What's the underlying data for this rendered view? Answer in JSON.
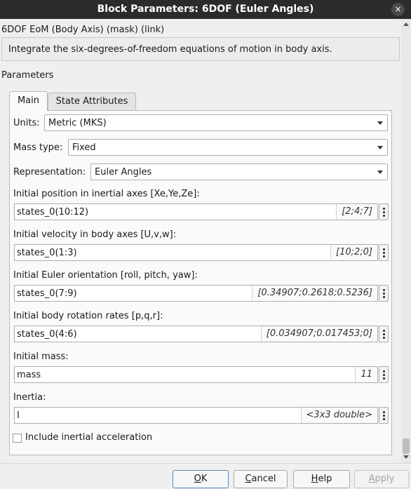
{
  "window": {
    "title": "Block Parameters: 6DOF (Euler Angles)",
    "close_icon": "×"
  },
  "header": {
    "mask_line": "6DOF EoM (Body Axis) (mask) (link)",
    "description": "Integrate the six-degrees-of-freedom equations of motion in body axis.",
    "parameters_label": "Parameters"
  },
  "tabs": [
    {
      "label": "Main",
      "active": true
    },
    {
      "label": "State Attributes",
      "active": false
    }
  ],
  "main": {
    "units": {
      "label": "Units:",
      "value": "Metric (MKS)"
    },
    "mass_type": {
      "label": "Mass type:",
      "value": "Fixed"
    },
    "representation": {
      "label": "Representation:",
      "value": "Euler Angles"
    },
    "fields": [
      {
        "label": "Initial position in inertial axes [Xe,Ye,Ze]:",
        "value": "states_0(10:12)",
        "hint": "[2;4;7]"
      },
      {
        "label": "Initial velocity in body axes [U,v,w]:",
        "value": "states_0(1:3)",
        "hint": "[10;2;0]"
      },
      {
        "label": "Initial Euler orientation [roll, pitch, yaw]:",
        "value": "states_0(7:9)",
        "hint": "[0.34907;0.2618;0.5236]"
      },
      {
        "label": "Initial body rotation rates [p,q,r]:",
        "value": "states_0(4:6)",
        "hint": "[0.034907;0.017453;0]"
      },
      {
        "label": "Initial mass:",
        "value": "mass",
        "hint": "11"
      },
      {
        "label": "Inertia:",
        "value": "I",
        "hint": "<3x3 double>"
      }
    ],
    "checkbox": {
      "label": "Include inertial acceleration",
      "checked": false
    }
  },
  "buttons": {
    "ok_mnemonic": "O",
    "ok_rest": "K",
    "cancel_mnemonic": "C",
    "cancel_rest": "ancel",
    "help_mnemonic": "H",
    "help_rest": "elp",
    "apply_mnemonic": "A",
    "apply_rest": "pply"
  },
  "colors": {
    "titlebar": "#2b2b2b",
    "disabled_text": "#a5a5a5",
    "default_button_border": "#5b87b8"
  }
}
